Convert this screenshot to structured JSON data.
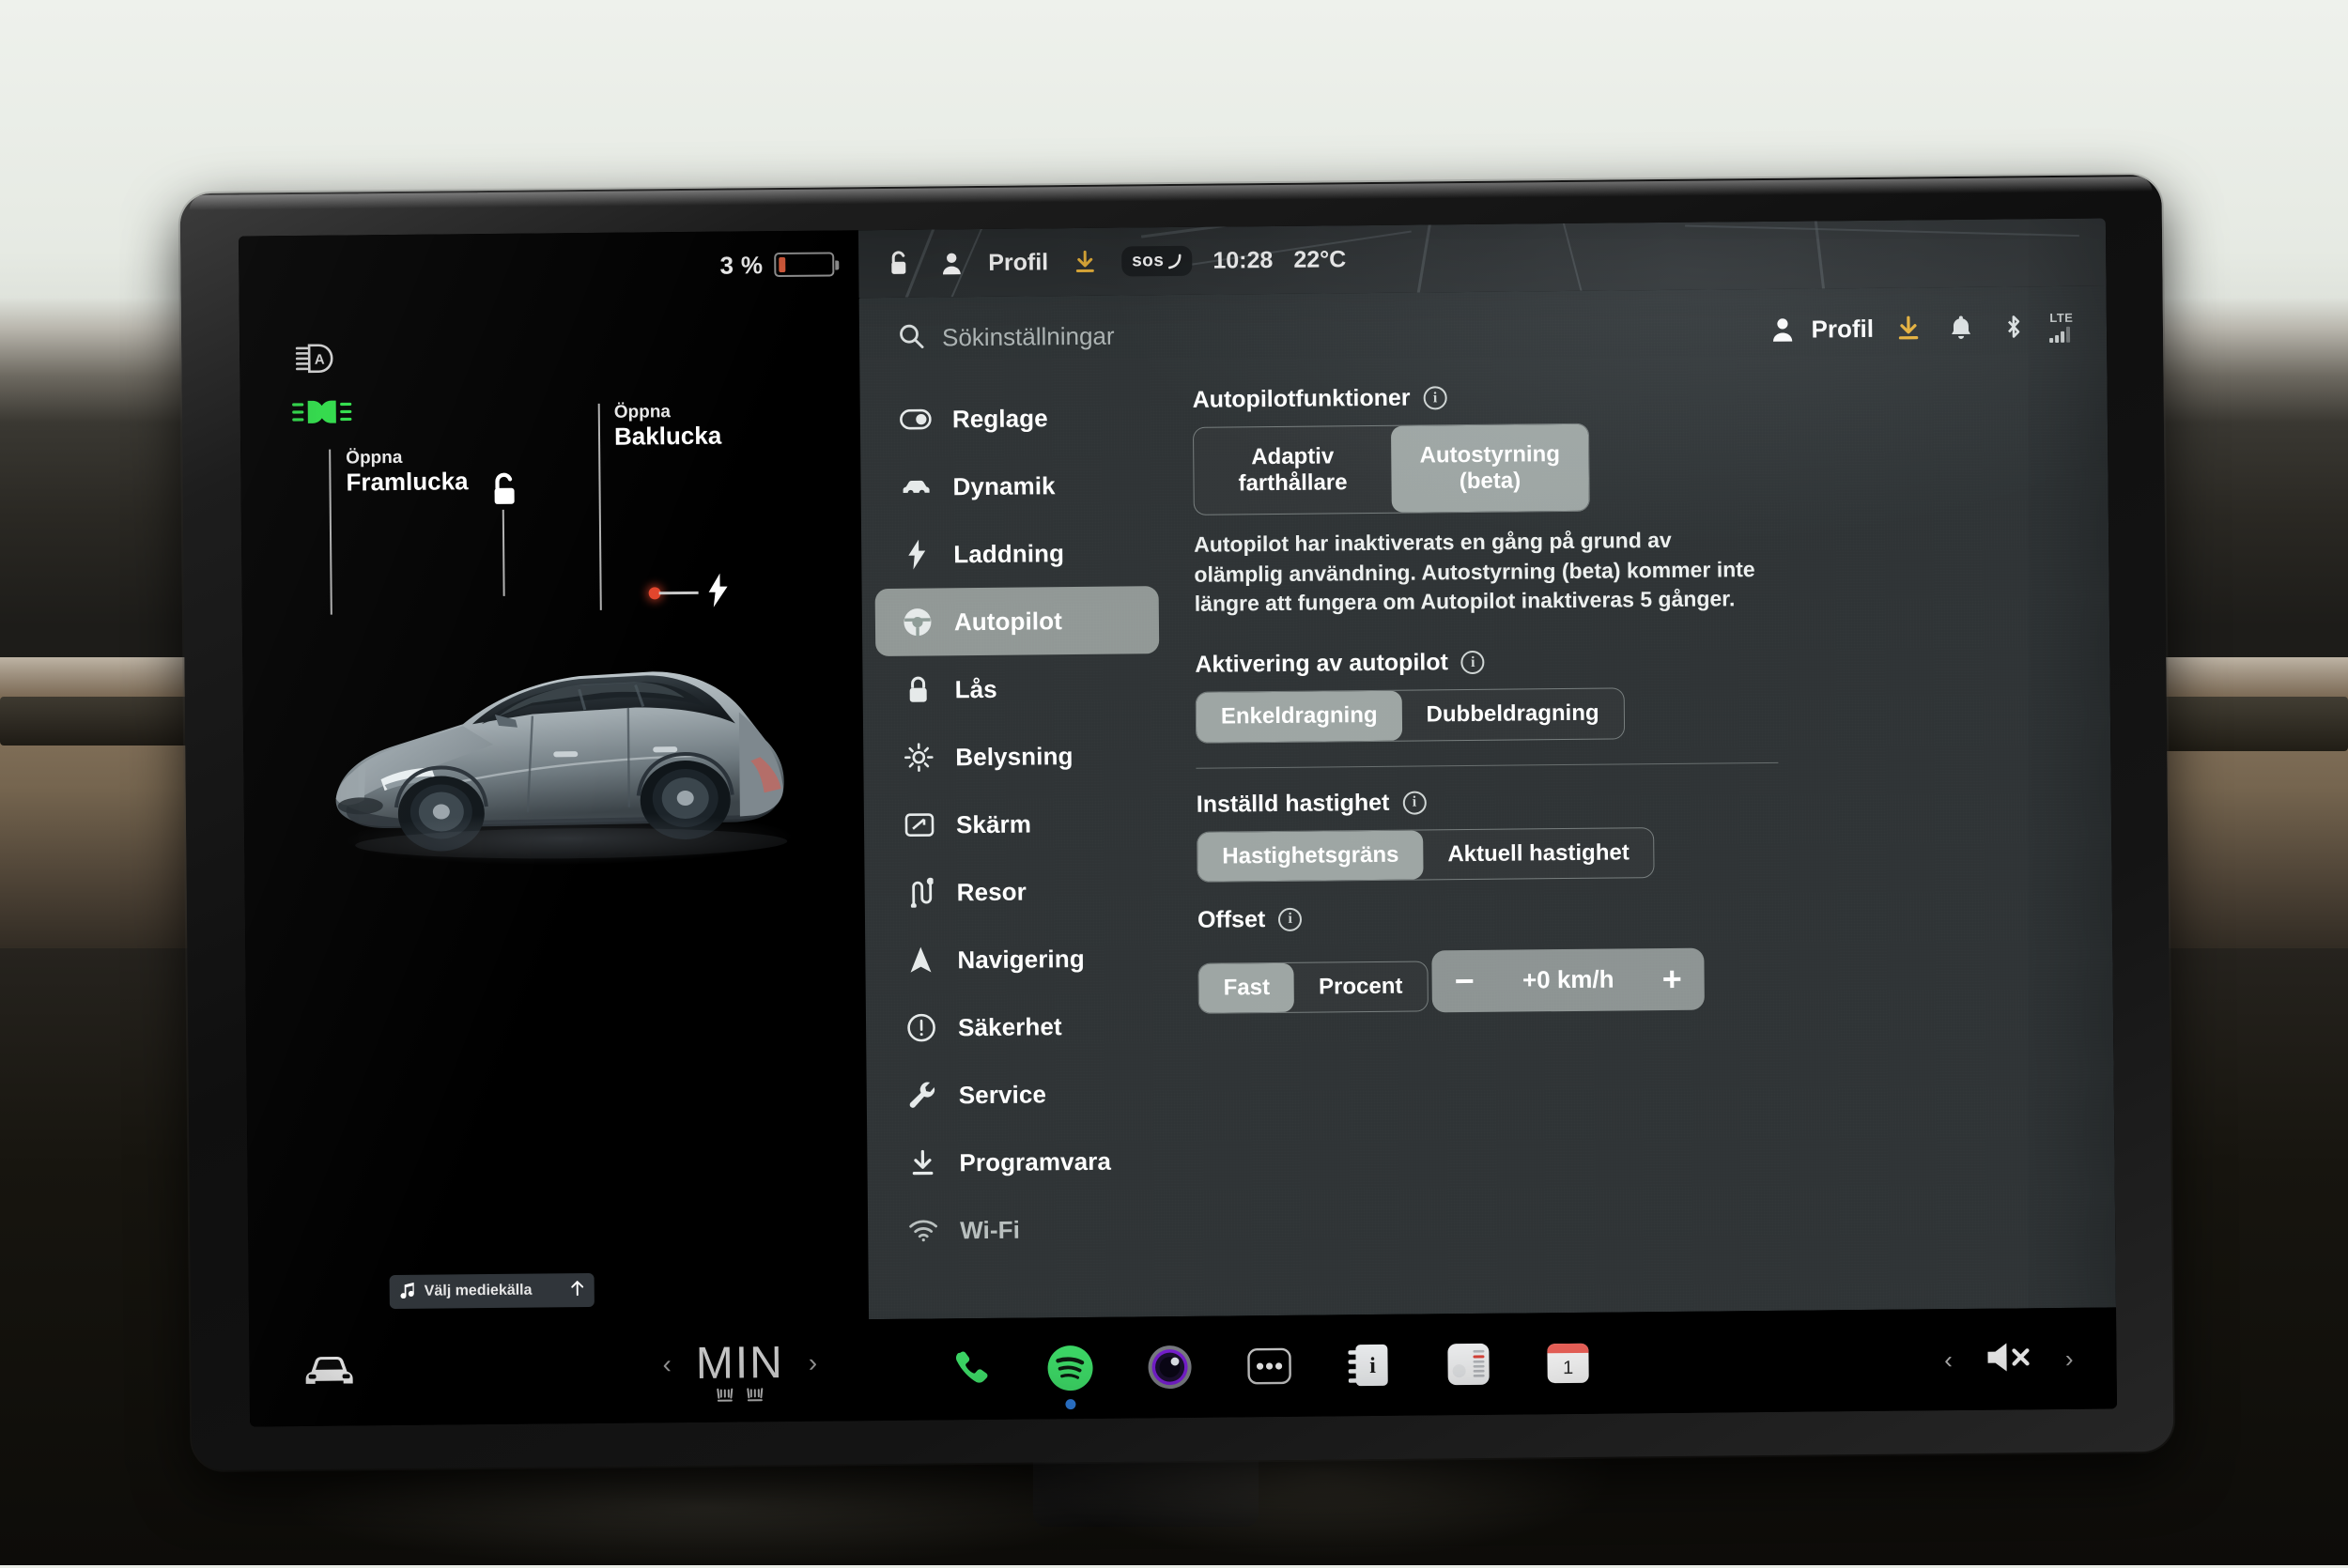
{
  "status_bar": {
    "battery_percent": "3 %",
    "lock_icon": "unlock-icon",
    "profile_icon": "person-icon",
    "profile_label": "Profil",
    "download_icon": "download-icon",
    "sos_label": "sos",
    "time": "10:28",
    "temperature": "22°C"
  },
  "car_view": {
    "telltales": [
      {
        "name": "auto-highbeam-icon",
        "state": "white"
      },
      {
        "name": "parking-lights-icon",
        "state": "green"
      }
    ],
    "pins": [
      {
        "top": "Öppna",
        "main": "Framlucka"
      },
      {
        "top": "Öppna",
        "main": "Baklucka"
      }
    ],
    "lock_icon": "unlock-icon",
    "charge_port_icon": "lightning-bolt-icon",
    "media_bar": {
      "music_icon": "music-note-icon",
      "label": "Välj mediekälla",
      "expand_icon": "arrow-up-icon"
    }
  },
  "settings": {
    "search": {
      "icon": "search-icon",
      "placeholder": "Sökinställningar"
    },
    "header_icons": [
      {
        "name": "person-icon",
        "label": "Profil"
      },
      {
        "name": "download-icon",
        "label": ""
      },
      {
        "name": "bell-icon",
        "label": ""
      },
      {
        "name": "bluetooth-icon",
        "label": ""
      },
      {
        "name": "lte-signal-icon",
        "label": "LTE"
      }
    ],
    "sidebar": [
      {
        "icon": "toggle-icon",
        "label": "Reglage",
        "active": false
      },
      {
        "icon": "car-icon",
        "label": "Dynamik",
        "active": false
      },
      {
        "icon": "bolt-icon",
        "label": "Laddning",
        "active": false
      },
      {
        "icon": "steering-icon",
        "label": "Autopilot",
        "active": true
      },
      {
        "icon": "lock-icon",
        "label": "Lås",
        "active": false
      },
      {
        "icon": "brightness-icon",
        "label": "Belysning",
        "active": false
      },
      {
        "icon": "display-icon",
        "label": "Skärm",
        "active": false
      },
      {
        "icon": "route-icon",
        "label": "Resor",
        "active": false
      },
      {
        "icon": "navigation-icon",
        "label": "Navigering",
        "active": false
      },
      {
        "icon": "alert-icon",
        "label": "Säkerhet",
        "active": false
      },
      {
        "icon": "wrench-icon",
        "label": "Service",
        "active": false
      },
      {
        "icon": "download-icon",
        "label": "Programvara",
        "active": false
      },
      {
        "icon": "wifi-icon",
        "label": "Wi-Fi",
        "active": false
      }
    ],
    "sections": {
      "autopilot_features": {
        "title": "Autopilotfunktioner",
        "options": [
          {
            "label": "Adaptiv\nfarthållare",
            "line1": "Adaptiv",
            "line2": "farthållare",
            "selected": false
          },
          {
            "label": "Autostyrning\n(beta)",
            "line1": "Autostyrning",
            "line2": "(beta)",
            "selected": true
          }
        ],
        "description": "Autopilot har inaktiverats en gång på grund av olämplig användning. Autostyrning (beta) kommer inte längre att fungera om Autopilot inaktiveras 5 gånger."
      },
      "autopilot_activation": {
        "title": "Aktivering av autopilot",
        "options": [
          {
            "label": "Enkeldragning",
            "selected": true
          },
          {
            "label": "Dubbeldragning",
            "selected": false
          }
        ]
      },
      "set_speed": {
        "title": "Inställd hastighet",
        "options": [
          {
            "label": "Hastighetsgräns",
            "selected": true
          },
          {
            "label": "Aktuell hastighet",
            "selected": false
          }
        ]
      },
      "offset": {
        "title": "Offset",
        "options": [
          {
            "label": "Fast",
            "selected": true
          },
          {
            "label": "Procent",
            "selected": false
          }
        ],
        "stepper": {
          "minus": "−",
          "value": "+0 km/h",
          "plus": "+"
        }
      }
    }
  },
  "dock": {
    "car_icon": "car-front-icon",
    "climate": {
      "prev_icon": "chevron-left-icon",
      "value": "MIN",
      "next_icon": "chevron-right-icon",
      "seat_icons": [
        "seat-heater-icon",
        "seat-heater-icon"
      ]
    },
    "apps": [
      {
        "name": "phone-icon",
        "label": ""
      },
      {
        "name": "spotify-icon",
        "label": "",
        "active": true
      },
      {
        "name": "camera-icon",
        "label": ""
      },
      {
        "name": "more-icon",
        "label": ""
      },
      {
        "name": "info-notes-icon",
        "label": ""
      },
      {
        "name": "list-app-icon",
        "label": ""
      },
      {
        "name": "calendar-icon",
        "label": "1"
      }
    ],
    "volume": {
      "prev_icon": "chevron-left-icon",
      "mute_icon": "volume-mute-icon",
      "next_icon": "chevron-right-icon"
    }
  },
  "colors": {
    "panel_bg": "#2f3436",
    "selected": "#c8d1cd",
    "accent_yellow": "#e9b33c",
    "battery_low": "#e3603f",
    "spotify_green": "#3fe06a",
    "calendar_red": "#f05b52"
  }
}
